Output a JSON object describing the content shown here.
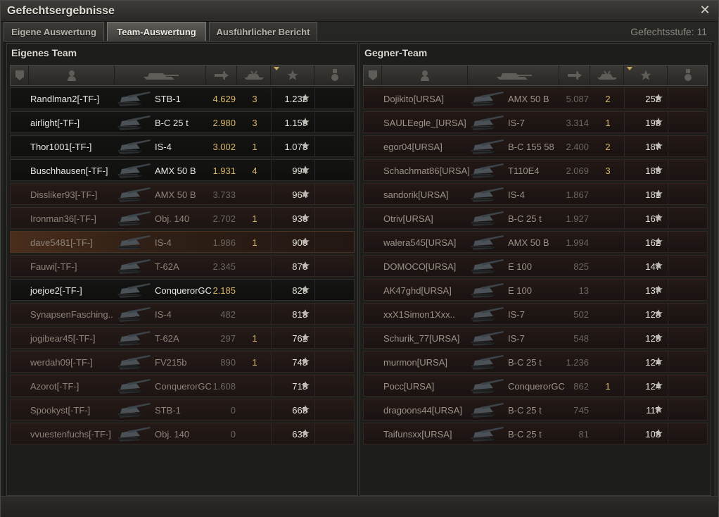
{
  "window": {
    "title": "Gefechtsergebnisse"
  },
  "tabs": [
    {
      "label": "Eigene Auswertung",
      "active": false
    },
    {
      "label": "Team-Auswertung",
      "active": true
    },
    {
      "label": "Ausführlicher Bericht",
      "active": false
    }
  ],
  "battle_tier": "Gefechtsstufe: 11",
  "columns": [
    "squad-icon",
    "player-icon",
    "tank-icon",
    "damage-icon",
    "kills-icon",
    "experience-star-icon",
    "medal-icon"
  ],
  "own_team": {
    "title": "Eigenes Team",
    "rows": [
      {
        "name": "Randlman2[-TF-]",
        "tank": "STB-1",
        "damage": "4.629",
        "kills": "3",
        "xp": "1.232",
        "state": "alive"
      },
      {
        "name": "airlight[-TF-]",
        "tank": "B-C 25 t",
        "damage": "2.980",
        "kills": "3",
        "xp": "1.159",
        "state": "alive"
      },
      {
        "name": "Thor1001[-TF-]",
        "tank": "IS-4",
        "damage": "3.002",
        "kills": "1",
        "xp": "1.073",
        "state": "alive"
      },
      {
        "name": "Buschhausen[-TF-]",
        "tank": "AMX 50 B",
        "damage": "1.931",
        "kills": "4",
        "xp": "994",
        "state": "alive"
      },
      {
        "name": "Dissliker93[-TF-]",
        "tank": "AMX 50 B",
        "damage": "3.733",
        "kills": "",
        "xp": "964",
        "state": "dead"
      },
      {
        "name": "Ironman36[-TF-]",
        "tank": "Obj. 140",
        "damage": "2.702",
        "kills": "1",
        "xp": "936",
        "state": "dead"
      },
      {
        "name": "dave5481[-TF-]",
        "tank": "IS-4",
        "damage": "1.986",
        "kills": "1",
        "xp": "900",
        "state": "self"
      },
      {
        "name": "Fauwi[-TF-]",
        "tank": "T-62A",
        "damage": "2.345",
        "kills": "",
        "xp": "876",
        "state": "dead"
      },
      {
        "name": "joejoe2[-TF-]",
        "tank": "ConquerorGC",
        "damage": "2.185",
        "kills": "",
        "xp": "829",
        "state": "alive"
      },
      {
        "name": "SynapsenFasching..",
        "tank": "IS-4",
        "damage": "482",
        "kills": "",
        "xp": "813",
        "state": "dead"
      },
      {
        "name": "jogibear45[-TF-]",
        "tank": "T-62A",
        "damage": "297",
        "kills": "1",
        "xp": "761",
        "state": "dead"
      },
      {
        "name": "werdah09[-TF-]",
        "tank": "FV215b",
        "damage": "890",
        "kills": "1",
        "xp": "745",
        "state": "dead"
      },
      {
        "name": "Azorot[-TF-]",
        "tank": "ConquerorGC",
        "damage": "1.608",
        "kills": "",
        "xp": "715",
        "state": "dead"
      },
      {
        "name": "Spookyst[-TF-]",
        "tank": "STB-1",
        "damage": "0",
        "kills": "",
        "xp": "665",
        "state": "dead"
      },
      {
        "name": "vvuestenfuchs[-TF-]",
        "tank": "Obj. 140",
        "damage": "0",
        "kills": "",
        "xp": "638",
        "state": "dead"
      }
    ]
  },
  "enemy_team": {
    "title": "Gegner-Team",
    "rows": [
      {
        "name": "Dojikito[URSA]",
        "tank": "AMX 50 B",
        "damage": "5.087",
        "kills": "2",
        "xp": "252",
        "state": "enemy"
      },
      {
        "name": "SAULEegle_[URSA]",
        "tank": "IS-7",
        "damage": "3.314",
        "kills": "1",
        "xp": "198",
        "state": "enemy"
      },
      {
        "name": "egor04[URSA]",
        "tank": "B-C 155 58",
        "damage": "2.400",
        "kills": "2",
        "xp": "187",
        "state": "enemy"
      },
      {
        "name": "Schachmat86[URSA]",
        "tank": "T110E4",
        "damage": "2.069",
        "kills": "3",
        "xp": "185",
        "state": "enemy"
      },
      {
        "name": "sandorik[URSA]",
        "tank": "IS-4",
        "damage": "1.867",
        "kills": "",
        "xp": "181",
        "state": "enemy"
      },
      {
        "name": "Otriv[URSA]",
        "tank": "B-C 25 t",
        "damage": "1.927",
        "kills": "",
        "xp": "167",
        "state": "enemy"
      },
      {
        "name": "walera545[URSA]",
        "tank": "AMX 50 B",
        "damage": "1.994",
        "kills": "",
        "xp": "162",
        "state": "enemy"
      },
      {
        "name": "DOMOCO[URSA]",
        "tank": "E 100",
        "damage": "825",
        "kills": "",
        "xp": "147",
        "state": "enemy"
      },
      {
        "name": "AK47ghd[URSA]",
        "tank": "E 100",
        "damage": "13",
        "kills": "",
        "xp": "137",
        "state": "enemy"
      },
      {
        "name": "xxX1Simon1Xxx..",
        "tank": "IS-7",
        "damage": "502",
        "kills": "",
        "xp": "128",
        "state": "enemy"
      },
      {
        "name": "Schurik_77[URSA]",
        "tank": "IS-7",
        "damage": "548",
        "kills": "",
        "xp": "125",
        "state": "enemy"
      },
      {
        "name": "murmon[URSA]",
        "tank": "B-C 25 t",
        "damage": "1.236",
        "kills": "",
        "xp": "124",
        "state": "enemy"
      },
      {
        "name": "Pocc[URSA]",
        "tank": "ConquerorGC",
        "damage": "862",
        "kills": "1",
        "xp": "124",
        "state": "enemy"
      },
      {
        "name": "dragoons44[URSA]",
        "tank": "B-C 25 t",
        "damage": "745",
        "kills": "",
        "xp": "117",
        "state": "enemy"
      },
      {
        "name": "Taifunsxx[URSA]",
        "tank": "B-C 25 t",
        "damage": "81",
        "kills": "",
        "xp": "103",
        "state": "enemy"
      }
    ]
  }
}
